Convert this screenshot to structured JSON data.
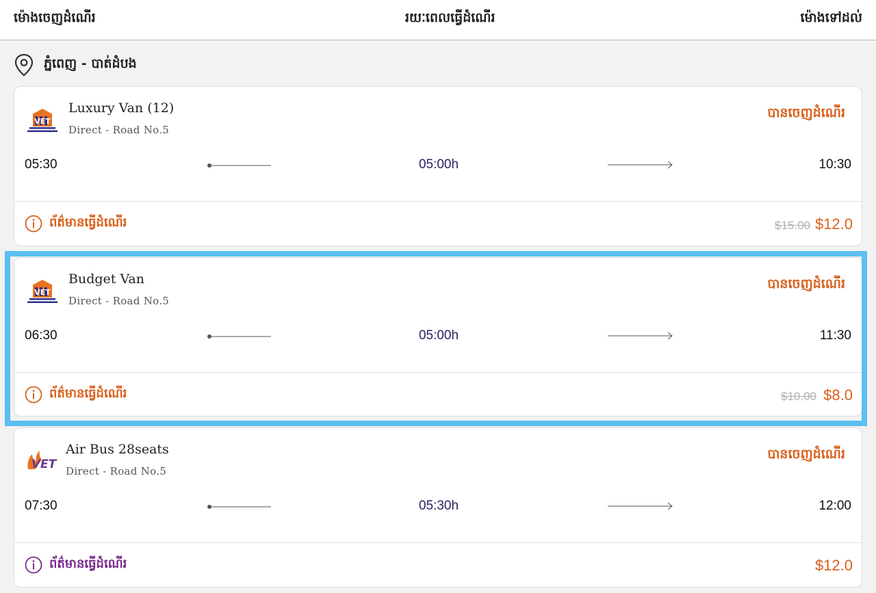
{
  "header": {
    "departure_label": "ម៉ោងចេញដំណើរ",
    "duration_label": "រយៈពេលធ្វើដំណើរ",
    "arrival_label": "ម៉ោងទៅដល់"
  },
  "route": {
    "icon": "location-pin-icon",
    "label": "ភ្នំពេញ - បាត់ដំបង"
  },
  "colors": {
    "accent": "#d9601c",
    "duration_text": "#25235e",
    "highlight": "#5bbff0",
    "info_purple": "#7a2a8c"
  },
  "trips": [
    {
      "name": "Luxury Van (12)",
      "route_detail": "Direct - Road No.5",
      "status": "បានចេញដំណើរ",
      "departure": "05:30",
      "duration": "05:00h",
      "arrival": "10:30",
      "info_label": "ព័ត៌មានធ្វើដំណើរ",
      "old_price": "$15.00",
      "price": "$12.0",
      "logo": "vet-building-logo"
    },
    {
      "name": "Budget Van",
      "route_detail": "Direct - Road No.5",
      "status": "បានចេញដំណើរ",
      "departure": "06:30",
      "duration": "05:00h",
      "arrival": "11:30",
      "info_label": "ព័ត៌មានធ្វើដំណើរ",
      "old_price": "$10.00",
      "price": "$8.0",
      "logo": "vet-building-logo"
    },
    {
      "name": "Air Bus 28seats",
      "route_detail": "Direct - Road No.5",
      "status": "បានចេញដំណើរ",
      "departure": "07:30",
      "duration": "05:30h",
      "arrival": "12:00",
      "info_label": "ព័ត៌មានធ្វើដំណើរ",
      "old_price": "",
      "price": "$12.0",
      "logo": "vet-airbus-logo"
    }
  ]
}
